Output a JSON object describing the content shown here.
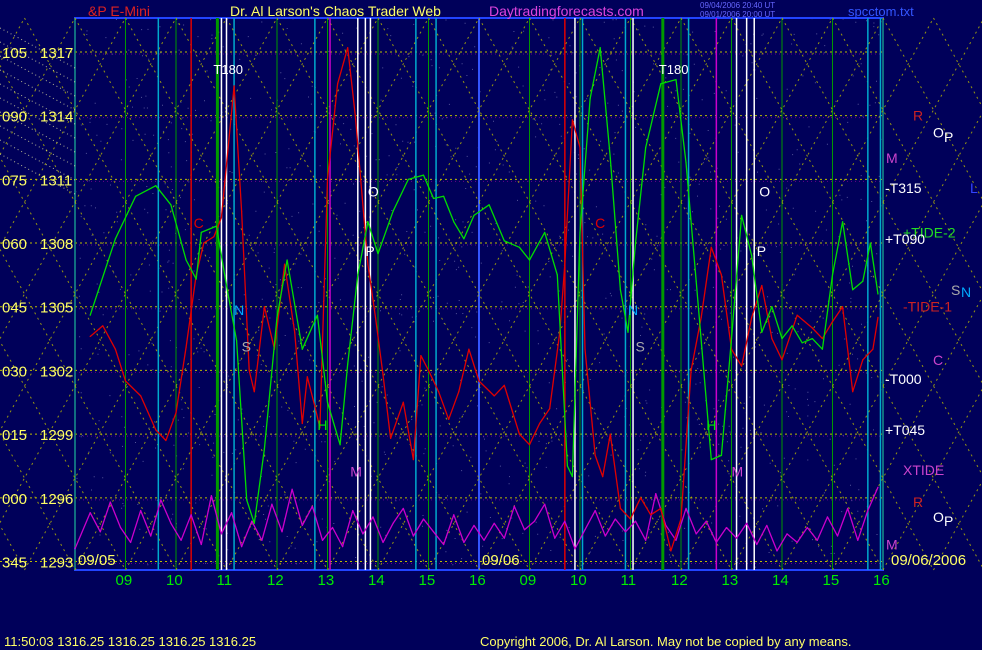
{
  "header": {
    "symbol": "&P E-Mini",
    "title": "Dr. Al Larson's Chaos Trader Web",
    "site": "Daytradingforecasts.com",
    "stamp_line1": "09/04/2006 20:40 UT",
    "stamp_line2": "09/01/2006 20:00 UT",
    "file": "spcctom.txt"
  },
  "footer": {
    "quote": "11:50:03  1316.25 1316.25 1316.25 1316.25",
    "copyright": "Copyright 2006, Dr. Al Larson. May not be copied by any means."
  },
  "colors": {
    "background": "#00005a",
    "price_label": "#ffff66",
    "time_label": "#00ee00",
    "price_curve": "#00dd00",
    "red_curve": "#e00000",
    "magenta_curve": "#cc00cc",
    "grid_yellow": "#bbbb00",
    "grid_green": "#009900",
    "grid_cyan": "#00aacc"
  },
  "chart_data": {
    "type": "line",
    "title": "Dr. Al Larson's Chaos Trader Web",
    "xlabel": "",
    "ylabel": "",
    "y_ticks": [
      {
        "deg": "105",
        "price": "1317",
        "value": 1317
      },
      {
        "deg": "090",
        "price": "1314",
        "value": 1314
      },
      {
        "deg": "075",
        "price": "1311",
        "value": 1311
      },
      {
        "deg": "060",
        "price": "1308",
        "value": 1308
      },
      {
        "deg": "045",
        "price": "1305",
        "value": 1305
      },
      {
        "deg": "030",
        "price": "1302",
        "value": 1302
      },
      {
        "deg": "015",
        "price": "1299",
        "value": 1299
      },
      {
        "deg": "000",
        "price": "1296",
        "value": 1296
      },
      {
        "deg": "345",
        "price": "1293",
        "value": 1293
      }
    ],
    "ylim": [
      1292.6,
      1318.6
    ],
    "x_ticks": [
      "09",
      "10",
      "11",
      "12",
      "13",
      "14",
      "15",
      "16",
      "09",
      "10",
      "11",
      "12",
      "13",
      "14",
      "15",
      "16"
    ],
    "date_labels": [
      "09/05",
      "09/06"
    ],
    "end_date": "09/06/2006",
    "xlim": [
      0,
      16
    ],
    "series": [
      {
        "name": "price",
        "role": "green",
        "points": [
          [
            0.3,
            1304.6
          ],
          [
            0.8,
            1308.2
          ],
          [
            1.2,
            1310.2
          ],
          [
            1.6,
            1310.7
          ],
          [
            1.9,
            1309.8
          ],
          [
            2.2,
            1307.2
          ],
          [
            2.4,
            1306.3
          ],
          [
            2.5,
            1308.5
          ],
          [
            2.8,
            1308.8
          ],
          [
            3.0,
            1306.0
          ],
          [
            3.2,
            1303.4
          ],
          [
            3.4,
            1295.9
          ],
          [
            3.55,
            1294.8
          ],
          [
            3.75,
            1298.3
          ],
          [
            4.0,
            1304.5
          ],
          [
            4.2,
            1307.2
          ],
          [
            4.5,
            1303.0
          ],
          [
            4.8,
            1304.6
          ],
          [
            5.0,
            1300.5
          ],
          [
            5.25,
            1298.5
          ],
          [
            5.4,
            1302.3
          ],
          [
            5.6,
            1306.5
          ],
          [
            5.8,
            1309.0
          ],
          [
            6.0,
            1307.5
          ],
          [
            6.3,
            1309.5
          ],
          [
            6.6,
            1311.0
          ],
          [
            6.9,
            1311.2
          ],
          [
            7.1,
            1310.1
          ],
          [
            7.3,
            1310.2
          ],
          [
            7.5,
            1309.0
          ],
          [
            7.7,
            1308.2
          ],
          [
            7.9,
            1309.3
          ],
          [
            8.2,
            1309.8
          ],
          [
            8.5,
            1308.1
          ],
          [
            8.8,
            1307.8
          ],
          [
            9.0,
            1307.2
          ],
          [
            9.3,
            1308.5
          ],
          [
            9.55,
            1306.5
          ],
          [
            9.75,
            1297.5
          ],
          [
            9.85,
            1297.0
          ],
          [
            10.0,
            1308.5
          ],
          [
            10.2,
            1314.8
          ],
          [
            10.4,
            1317.2
          ],
          [
            10.6,
            1312.0
          ],
          [
            10.8,
            1305.8
          ],
          [
            10.95,
            1303.8
          ],
          [
            11.1,
            1308.0
          ],
          [
            11.3,
            1312.5
          ],
          [
            11.6,
            1315.5
          ],
          [
            11.9,
            1315.7
          ],
          [
            12.1,
            1311.8
          ],
          [
            12.3,
            1306.2
          ],
          [
            12.6,
            1297.8
          ],
          [
            12.8,
            1298.0
          ],
          [
            13.0,
            1303.5
          ],
          [
            13.2,
            1309.3
          ],
          [
            13.4,
            1307.4
          ],
          [
            13.6,
            1303.8
          ],
          [
            13.8,
            1305.0
          ],
          [
            14.0,
            1303.5
          ],
          [
            14.2,
            1304.1
          ],
          [
            14.4,
            1303.3
          ],
          [
            14.6,
            1303.5
          ],
          [
            14.8,
            1303.0
          ],
          [
            15.0,
            1306.5
          ],
          [
            15.2,
            1309.0
          ],
          [
            15.4,
            1305.8
          ],
          [
            15.6,
            1306.2
          ],
          [
            15.75,
            1308.0
          ],
          [
            15.9,
            1305.6
          ]
        ]
      },
      {
        "name": "",
        "role": "red",
        "points": [
          [
            0.3,
            1303.6
          ],
          [
            0.55,
            1304.1
          ],
          [
            0.8,
            1303.0
          ],
          [
            1.0,
            1301.5
          ],
          [
            1.3,
            1300.8
          ],
          [
            1.6,
            1299.2
          ],
          [
            1.8,
            1298.7
          ],
          [
            2.0,
            1300.0
          ],
          [
            2.2,
            1303.1
          ],
          [
            2.4,
            1306.5
          ],
          [
            2.55,
            1308.0
          ],
          [
            2.75,
            1308.3
          ],
          [
            2.9,
            1309.2
          ],
          [
            3.15,
            1315.4
          ],
          [
            3.3,
            1309.5
          ],
          [
            3.45,
            1302.0
          ],
          [
            3.55,
            1301.0
          ],
          [
            3.75,
            1305.0
          ],
          [
            3.95,
            1303.0
          ],
          [
            4.15,
            1307.0
          ],
          [
            4.35,
            1303.8
          ],
          [
            4.5,
            1299.5
          ],
          [
            4.6,
            1301.7
          ],
          [
            4.75,
            1300.3
          ],
          [
            4.85,
            1299.3
          ],
          [
            5.0,
            1311.0
          ],
          [
            5.2,
            1315.5
          ],
          [
            5.4,
            1317.2
          ],
          [
            5.55,
            1314.0
          ],
          [
            5.8,
            1307.0
          ],
          [
            5.95,
            1304.5
          ],
          [
            6.1,
            1301.8
          ],
          [
            6.25,
            1298.8
          ],
          [
            6.5,
            1300.5
          ],
          [
            6.7,
            1297.8
          ],
          [
            6.85,
            1302.7
          ],
          [
            7.0,
            1302.0
          ],
          [
            7.2,
            1301.0
          ],
          [
            7.4,
            1299.7
          ],
          [
            7.6,
            1301.0
          ],
          [
            7.8,
            1303.0
          ],
          [
            8.0,
            1301.5
          ],
          [
            8.3,
            1300.8
          ],
          [
            8.5,
            1301.3
          ],
          [
            8.8,
            1299.0
          ],
          [
            9.0,
            1298.5
          ],
          [
            9.2,
            1299.5
          ],
          [
            9.4,
            1300.2
          ],
          [
            9.6,
            1303.8
          ],
          [
            9.7,
            1307.0
          ],
          [
            9.85,
            1313.8
          ],
          [
            10.0,
            1312.5
          ],
          [
            10.1,
            1303.0
          ],
          [
            10.3,
            1298.0
          ],
          [
            10.45,
            1297.0
          ],
          [
            10.6,
            1299.0
          ],
          [
            10.8,
            1295.5
          ],
          [
            11.0,
            1295.0
          ],
          [
            11.2,
            1296.0
          ],
          [
            11.4,
            1295.2
          ],
          [
            11.6,
            1295.5
          ],
          [
            11.8,
            1293.5
          ],
          [
            12.0,
            1295.0
          ],
          [
            12.2,
            1302.0
          ],
          [
            12.4,
            1304.5
          ],
          [
            12.6,
            1307.8
          ],
          [
            12.8,
            1306.5
          ],
          [
            13.0,
            1303.0
          ],
          [
            13.2,
            1302.2
          ],
          [
            13.4,
            1304.5
          ],
          [
            13.6,
            1306.0
          ],
          [
            13.8,
            1303.5
          ],
          [
            14.0,
            1302.5
          ],
          [
            14.3,
            1304.6
          ],
          [
            14.6,
            1304.0
          ],
          [
            14.8,
            1303.5
          ],
          [
            15.0,
            1304.3
          ],
          [
            15.2,
            1305.0
          ],
          [
            15.4,
            1301.0
          ],
          [
            15.6,
            1302.5
          ],
          [
            15.8,
            1303.0
          ],
          [
            15.9,
            1304.5
          ]
        ]
      },
      {
        "name": "",
        "role": "magenta",
        "points": [
          [
            0.0,
            1293.6
          ],
          [
            0.3,
            1295.3
          ],
          [
            0.5,
            1294.4
          ],
          [
            0.7,
            1295.8
          ],
          [
            0.9,
            1294.6
          ],
          [
            1.1,
            1293.9
          ],
          [
            1.3,
            1295.4
          ],
          [
            1.5,
            1294.2
          ],
          [
            1.7,
            1295.9
          ],
          [
            1.9,
            1294.8
          ],
          [
            2.1,
            1294.0
          ],
          [
            2.3,
            1295.2
          ],
          [
            2.5,
            1293.8
          ],
          [
            2.7,
            1296.1
          ],
          [
            2.9,
            1294.3
          ],
          [
            3.1,
            1295.3
          ],
          [
            3.3,
            1293.7
          ],
          [
            3.5,
            1294.9
          ],
          [
            3.7,
            1294.0
          ],
          [
            3.9,
            1295.7
          ],
          [
            4.1,
            1294.4
          ],
          [
            4.3,
            1296.4
          ],
          [
            4.5,
            1294.7
          ],
          [
            4.7,
            1295.6
          ],
          [
            4.9,
            1294.0
          ],
          [
            5.1,
            1294.6
          ],
          [
            5.3,
            1293.7
          ],
          [
            5.5,
            1295.4
          ],
          [
            5.7,
            1294.3
          ],
          [
            5.9,
            1295.1
          ],
          [
            6.1,
            1293.9
          ],
          [
            6.3,
            1294.8
          ],
          [
            6.5,
            1295.5
          ],
          [
            6.7,
            1294.2
          ],
          [
            6.9,
            1295.0
          ],
          [
            7.1,
            1294.4
          ],
          [
            7.3,
            1293.8
          ],
          [
            7.5,
            1295.2
          ],
          [
            7.7,
            1293.9
          ],
          [
            7.9,
            1294.7
          ],
          [
            8.1,
            1294.0
          ],
          [
            8.3,
            1294.8
          ],
          [
            8.5,
            1294.1
          ],
          [
            8.7,
            1295.6
          ],
          [
            8.9,
            1294.5
          ],
          [
            9.1,
            1294.9
          ],
          [
            9.3,
            1295.7
          ],
          [
            9.5,
            1294.1
          ],
          [
            9.7,
            1294.9
          ],
          [
            9.9,
            1293.6
          ],
          [
            10.1,
            1294.5
          ],
          [
            10.3,
            1295.4
          ],
          [
            10.5,
            1294.2
          ],
          [
            10.7,
            1295.0
          ],
          [
            10.9,
            1294.4
          ],
          [
            11.1,
            1294.9
          ],
          [
            11.3,
            1294.0
          ],
          [
            11.5,
            1296.2
          ],
          [
            11.7,
            1294.7
          ],
          [
            11.9,
            1294.0
          ],
          [
            12.1,
            1295.5
          ],
          [
            12.3,
            1294.3
          ],
          [
            12.5,
            1294.9
          ],
          [
            12.7,
            1293.9
          ],
          [
            12.9,
            1294.6
          ],
          [
            13.1,
            1294.1
          ],
          [
            13.3,
            1294.8
          ],
          [
            13.5,
            1293.8
          ],
          [
            13.7,
            1294.7
          ],
          [
            13.9,
            1293.5
          ],
          [
            14.1,
            1294.3
          ],
          [
            14.3,
            1293.9
          ],
          [
            14.5,
            1294.6
          ],
          [
            14.7,
            1294.0
          ],
          [
            14.9,
            1295.1
          ],
          [
            15.1,
            1294.2
          ],
          [
            15.3,
            1295.5
          ],
          [
            15.5,
            1294.0
          ],
          [
            15.7,
            1295.4
          ],
          [
            15.9,
            1296.5
          ]
        ]
      }
    ],
    "time_markers": [
      {
        "x": 2.82,
        "label": "T180"
      },
      {
        "x": 11.64,
        "label": "T180"
      }
    ],
    "curve_letters": [
      {
        "x": 2.35,
        "y": 1308.7,
        "label": "C",
        "color": "#e00000"
      },
      {
        "x": 3.15,
        "y": 1304.6,
        "label": "N",
        "color": "#00aaff"
      },
      {
        "x": 3.3,
        "y": 1302.9,
        "label": "S",
        "color": "#aaaaaa"
      },
      {
        "x": 4.8,
        "y": 1299.2,
        "label": "H",
        "color": "#00ee00"
      },
      {
        "x": 5.45,
        "y": 1297.0,
        "label": "M",
        "color": "#cc44cc"
      },
      {
        "x": 5.8,
        "y": 1310.2,
        "label": "O",
        "color": "#ffffff"
      },
      {
        "x": 5.75,
        "y": 1307.4,
        "label": "P",
        "color": "#ffffff"
      },
      {
        "x": 10.3,
        "y": 1308.7,
        "label": "C",
        "color": "#e00000"
      },
      {
        "x": 10.95,
        "y": 1304.6,
        "label": "N",
        "color": "#00aaff"
      },
      {
        "x": 11.1,
        "y": 1302.9,
        "label": "S",
        "color": "#aaaaaa"
      },
      {
        "x": 12.5,
        "y": 1299.2,
        "label": "H",
        "color": "#00ee00"
      },
      {
        "x": 13.0,
        "y": 1297.0,
        "label": "M",
        "color": "#cc44cc"
      },
      {
        "x": 13.55,
        "y": 1310.2,
        "label": "O",
        "color": "#ffffff"
      },
      {
        "x": 13.5,
        "y": 1307.4,
        "label": "P",
        "color": "#ffffff"
      }
    ],
    "right_labels": [
      {
        "label": "R",
        "y": 1314.0,
        "color": "#cc2222"
      },
      {
        "label": "O",
        "y": 1313.2,
        "color": "#ffffff"
      },
      {
        "label": "P",
        "y": 1313.0,
        "color": "#ffffff"
      },
      {
        "label": "M",
        "y": 1312.0,
        "color": "#cc44cc"
      },
      {
        "label": "-T315",
        "y": 1310.6,
        "color": "#ffffff"
      },
      {
        "label": "L",
        "y": 1310.6,
        "color": "#3344ff"
      },
      {
        "label": "+TIDE-2",
        "y": 1308.5,
        "color": "#22dd22"
      },
      {
        "label": "+T090",
        "y": 1308.2,
        "color": "#ffffff"
      },
      {
        "label": "S",
        "y": 1305.8,
        "color": "#aaaaaa"
      },
      {
        "label": "N",
        "y": 1305.7,
        "color": "#00aaff"
      },
      {
        "label": "-TIDE-1",
        "y": 1305.0,
        "color": "#cc2222"
      },
      {
        "label": "C",
        "y": 1302.5,
        "color": "#cc44cc"
      },
      {
        "label": "-T000",
        "y": 1301.6,
        "color": "#ffffff"
      },
      {
        "label": "+T045",
        "y": 1299.2,
        "color": "#ffffff"
      },
      {
        "label": "XTIDE",
        "y": 1297.3,
        "color": "#cc44cc"
      },
      {
        "label": "R",
        "y": 1295.8,
        "color": "#cc2222"
      },
      {
        "label": "O",
        "y": 1295.1,
        "color": "#ffffff"
      },
      {
        "label": "P",
        "y": 1294.9,
        "color": "#ffffff"
      },
      {
        "label": "M",
        "y": 1293.8,
        "color": "#cc44cc"
      }
    ]
  }
}
